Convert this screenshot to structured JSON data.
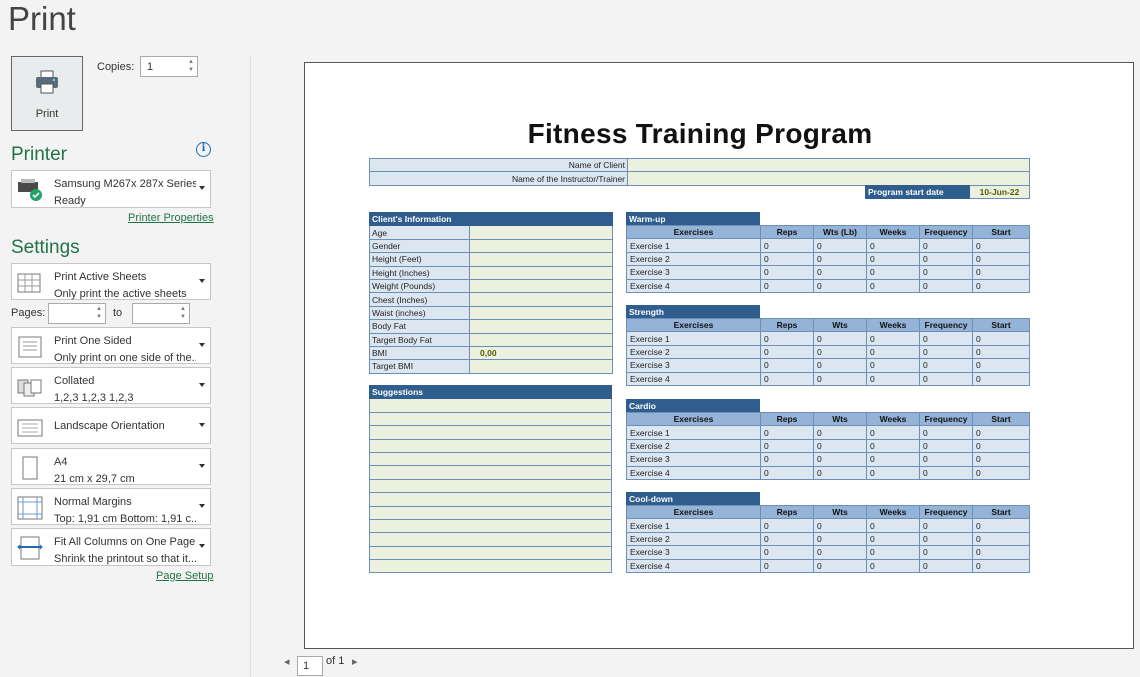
{
  "page": {
    "title": "Print"
  },
  "print_button": {
    "label": "Print"
  },
  "copies": {
    "label": "Copies:",
    "value": "1"
  },
  "printer": {
    "heading": "Printer",
    "name": "Samsung M267x 287x Series...",
    "status": "Ready",
    "properties_link": "Printer Properties"
  },
  "settings": {
    "heading": "Settings",
    "sheets": {
      "title": "Print Active Sheets",
      "sub": "Only print the active sheets"
    },
    "pages_label": "Pages:",
    "to_label": "to",
    "sided": {
      "title": "Print One Sided",
      "sub": "Only print on one side of the..."
    },
    "collated": {
      "title": "Collated",
      "sub": "1,2,3    1,2,3    1,2,3"
    },
    "orientation": {
      "title": "Landscape Orientation"
    },
    "paper": {
      "title": "A4",
      "sub": "21 cm x 29,7 cm"
    },
    "margins": {
      "title": "Normal Margins",
      "sub": "Top: 1,91 cm Bottom: 1,91 c..."
    },
    "scaling": {
      "title": "Fit All Columns on One Page",
      "sub": "Shrink the printout so that it..."
    },
    "page_setup_link": "Page Setup"
  },
  "pager": {
    "current": "1",
    "of": "of 1"
  },
  "doc": {
    "title": "Fitness Training Program",
    "client_label": "Name of Client",
    "instructor_label": "Name of the Instructor/Trainer",
    "start_label": "Program start date",
    "start_value": "10-Jun-22",
    "client_info": {
      "heading": "Client's Information",
      "rows": [
        "Age",
        "Gender",
        "Height (Feet)",
        "Height (Inches)",
        "Weight (Pounds)",
        "Chest (Inches)",
        "Waist (inches)",
        "Body Fat",
        "Target Body Fat",
        "BMI",
        "Target BMI"
      ],
      "bmi_value": "0,00"
    },
    "suggestions": {
      "heading": "Suggestions"
    },
    "sections": [
      {
        "name": "Warm-up",
        "cols": [
          "Exercises",
          "Reps",
          "Wts (Lb)",
          "Weeks",
          "Frequency",
          "Start"
        ],
        "rows": [
          "Exercise 1",
          "Exercise 2",
          "Exercise 3",
          "Exercise 4"
        ]
      },
      {
        "name": "Strength",
        "cols": [
          "Exercises",
          "Reps",
          "Wts",
          "Weeks",
          "Frequency",
          "Start"
        ],
        "rows": [
          "Exercise 1",
          "Exercise 2",
          "Exercise 3",
          "Exercise 4"
        ]
      },
      {
        "name": "Cardio",
        "cols": [
          "Exercises",
          "Reps",
          "Wts",
          "Weeks",
          "Frequency",
          "Start"
        ],
        "rows": [
          "Exercise 1",
          "Exercise 2",
          "Exercise 3",
          "Exercise 4"
        ]
      },
      {
        "name": "Cool-down",
        "cols": [
          "Exercises",
          "Reps",
          "Wts",
          "Weeks",
          "Frequency",
          "Start"
        ],
        "rows": [
          "Exercise 1",
          "Exercise 2",
          "Exercise 3",
          "Exercise 4"
        ]
      }
    ],
    "zero": "0"
  }
}
